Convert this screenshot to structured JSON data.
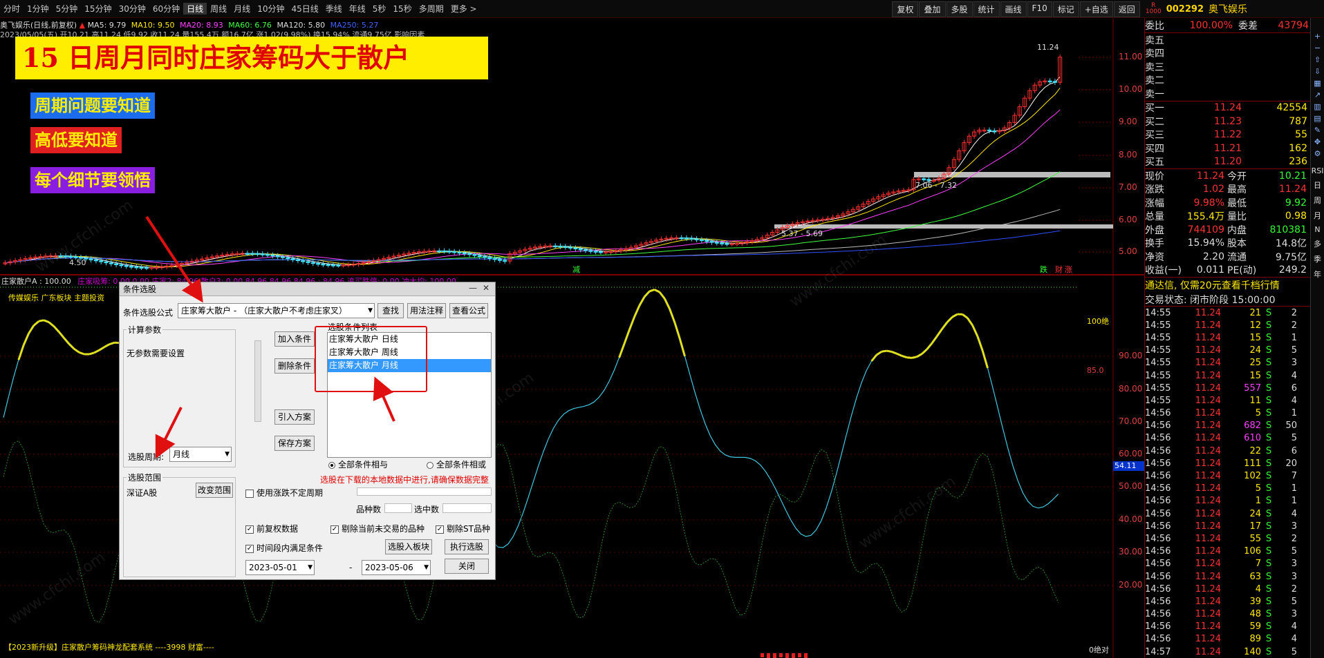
{
  "topbar": {
    "periods": [
      "分时",
      "1分钟",
      "5分钟",
      "15分钟",
      "30分钟",
      "60分钟",
      "日线",
      "周线",
      "月线",
      "10分钟",
      "45日线",
      "季线",
      "年线",
      "5秒",
      "15秒",
      "多周期",
      "更多 >"
    ],
    "active_period": "日线",
    "tools": [
      "复权",
      "叠加",
      "多股",
      "统计",
      "画线",
      "F10",
      "标记",
      "+自选",
      "返回"
    ],
    "stock_code": "002292",
    "stock_name": "奥飞娱乐"
  },
  "chart_info": {
    "title": "奥飞娱乐(日线,前复权)",
    "ma_line": [
      "MA5: 9.79",
      "MA10: 9.50",
      "MA20: 8.93",
      "MA60: 6.76",
      "MA120: 5.80",
      "MA250: 5.27"
    ],
    "date_line": "2023/05/05(五) 开10.21 高11.24 低9.92 收11.24 量155.4万 额16.7亿 涨1.02(9.98%) 换15.94% 流通9.75亿 影响因素"
  },
  "banners": {
    "main": "15  日周月同时庄家筹码大于散户",
    "b1": "周期问题要知道",
    "b2": "高低要知道",
    "b3": "每个细节要领悟"
  },
  "price_axis": [
    "11.00",
    "10.00",
    "9.00",
    "8.00",
    "7.00",
    "6.00",
    "5.00"
  ],
  "chart_labels": {
    "high": "11.24",
    "low": "4.50",
    "range1": "7.06 - 7.32",
    "range2": "5.37 - 5.69",
    "tag_jian": "减",
    "tag_die": "跌",
    "tag_cai": "财",
    "tag_zhang": "涨"
  },
  "indicator": {
    "header": "庄家散户A : 100.00",
    "header2": "庄家吸筹: 0.00  0.00 庄家2: 84.96  散户3: 0.00  84.96  84.96  84.96 : 84.96  追买跌停: 0.00  冲大均: 100.00",
    "sub_header": "传媒娱乐 广东板块 主题投资",
    "axis": [
      "90.00",
      "80.00",
      "70.00",
      "60.00",
      "50.00",
      "40.00",
      "30.00",
      "20.00"
    ],
    "cur_value": "54.11",
    "label_100": "100绝",
    "label_85": "85.0",
    "label_0": "0绝对",
    "bottom": "【2023新升级】庄家散户筹码神龙配套系统 ----3998 财富----"
  },
  "quote": {
    "weibi": {
      "label": "委比",
      "value": "100.00%",
      "label2": "委差",
      "value2": "43794"
    },
    "sells": [
      "卖五",
      "卖四",
      "卖三",
      "卖二",
      "卖一"
    ],
    "buys": [
      {
        "label": "买一",
        "price": "11.24",
        "vol": "42554"
      },
      {
        "label": "买二",
        "price": "11.23",
        "vol": "787"
      },
      {
        "label": "买三",
        "price": "11.22",
        "vol": "55"
      },
      {
        "label": "买四",
        "price": "11.21",
        "vol": "162"
      },
      {
        "label": "买五",
        "price": "11.20",
        "vol": "236"
      }
    ],
    "stats": [
      {
        "k1": "现价",
        "v1": "11.24",
        "k2": "今开",
        "v2": "10.21"
      },
      {
        "k1": "涨跌",
        "v1": "1.02",
        "k2": "最高",
        "v2": "11.24"
      },
      {
        "k1": "涨幅",
        "v1": "9.98%",
        "k2": "最低",
        "v2": "9.92"
      },
      {
        "k1": "总量",
        "v1": "155.4万",
        "k2": "量比",
        "v2": "0.98"
      },
      {
        "k1": "外盘",
        "v1": "744109",
        "k2": "内盘",
        "v2": "810381"
      },
      {
        "k1": "换手",
        "v1": "15.94%",
        "k2": "股本",
        "v2": "14.8亿"
      },
      {
        "k1": "净资",
        "v1": "2.20",
        "k2": "流通",
        "v2": "9.75亿"
      },
      {
        "k1": "收益(一)",
        "v1": "0.011",
        "k2": "PE(动)",
        "v2": "249.2"
      }
    ],
    "notice": "通达信, 仅需20元查看千档行情",
    "trade_status": "交易状态: 闭市阶段 15:00:00",
    "ticks": [
      [
        "14:55",
        "11.24",
        "21",
        "S",
        "2"
      ],
      [
        "14:55",
        "11.24",
        "12",
        "S",
        "2"
      ],
      [
        "14:55",
        "11.24",
        "15",
        "S",
        "1"
      ],
      [
        "14:55",
        "11.24",
        "24",
        "S",
        "5"
      ],
      [
        "14:55",
        "11.24",
        "25",
        "S",
        "3"
      ],
      [
        "14:55",
        "11.24",
        "15",
        "S",
        "4"
      ],
      [
        "14:55",
        "11.24",
        "557",
        "S",
        "6"
      ],
      [
        "14:55",
        "11.24",
        "11",
        "S",
        "4"
      ],
      [
        "14:56",
        "11.24",
        "5",
        "S",
        "1"
      ],
      [
        "14:56",
        "11.24",
        "682",
        "S",
        "50"
      ],
      [
        "14:56",
        "11.24",
        "610",
        "S",
        "5"
      ],
      [
        "14:56",
        "11.24",
        "22",
        "S",
        "6"
      ],
      [
        "14:56",
        "11.24",
        "111",
        "S",
        "20"
      ],
      [
        "14:56",
        "11.24",
        "102",
        "S",
        "7"
      ],
      [
        "14:56",
        "11.24",
        "5",
        "S",
        "1"
      ],
      [
        "14:56",
        "11.24",
        "1",
        "S",
        "1"
      ],
      [
        "14:56",
        "11.24",
        "24",
        "S",
        "4"
      ],
      [
        "14:56",
        "11.24",
        "17",
        "S",
        "3"
      ],
      [
        "14:56",
        "11.24",
        "55",
        "S",
        "2"
      ],
      [
        "14:56",
        "11.24",
        "106",
        "S",
        "5"
      ],
      [
        "14:56",
        "11.24",
        "7",
        "S",
        "3"
      ],
      [
        "14:56",
        "11.24",
        "63",
        "S",
        "3"
      ],
      [
        "14:56",
        "11.24",
        "4",
        "S",
        "2"
      ],
      [
        "14:56",
        "11.24",
        "39",
        "S",
        "5"
      ],
      [
        "14:56",
        "11.24",
        "48",
        "S",
        "3"
      ],
      [
        "14:56",
        "11.24",
        "59",
        "S",
        "4"
      ],
      [
        "14:56",
        "11.24",
        "89",
        "S",
        "4"
      ],
      [
        "14:57",
        "11.24",
        "140",
        "S",
        "5"
      ]
    ]
  },
  "sidebar_icons": [
    "RSI",
    "日",
    "周",
    "月",
    "N",
    "多",
    "季",
    "年"
  ],
  "dialog": {
    "title": "条件选股",
    "formula_label": "条件选股公式",
    "formula_value": "庄家筹大散户 - （庄家大散户不考虑庄家叉）",
    "btn_find": "查找",
    "btn_usage": "用法注释",
    "btn_view": "查看公式",
    "params_group": "计算参数",
    "params_text": "无参数需要设置",
    "period_label": "选股周期:",
    "period_value": "月线",
    "btn_add": "加入条件",
    "btn_del": "删除条件",
    "btn_import": "引入方案",
    "btn_save": "保存方案",
    "list_label": "选股条件列表",
    "list_items": [
      "庄家筹大散户  日线",
      "庄家筹大散户  周线",
      "庄家筹大散户  月线"
    ],
    "radio_and": "全部条件相与",
    "radio_or": "全部条件相或",
    "scope_group": "选股范围",
    "scope_value": "深证A股",
    "btn_scope": "改变范围",
    "warn": "选股在下载的本地数据中进行,请确保数据完整",
    "chk_variable": "使用涨跌不定周期",
    "count_label": "品种数",
    "selected_label": "选中数",
    "chk_fq": "前复权数据",
    "chk_notrade": "剔除当前未交易的品种",
    "chk_st": "剔除ST品种",
    "chk_time": "时间段内满足条件",
    "btn_board": "选股入板块",
    "btn_run": "执行选股",
    "date_from": "2023-05-01",
    "date_to": "2023-05-06",
    "dash": "-",
    "btn_close": "关闭"
  },
  "watermark": "www.cfchi.com"
}
